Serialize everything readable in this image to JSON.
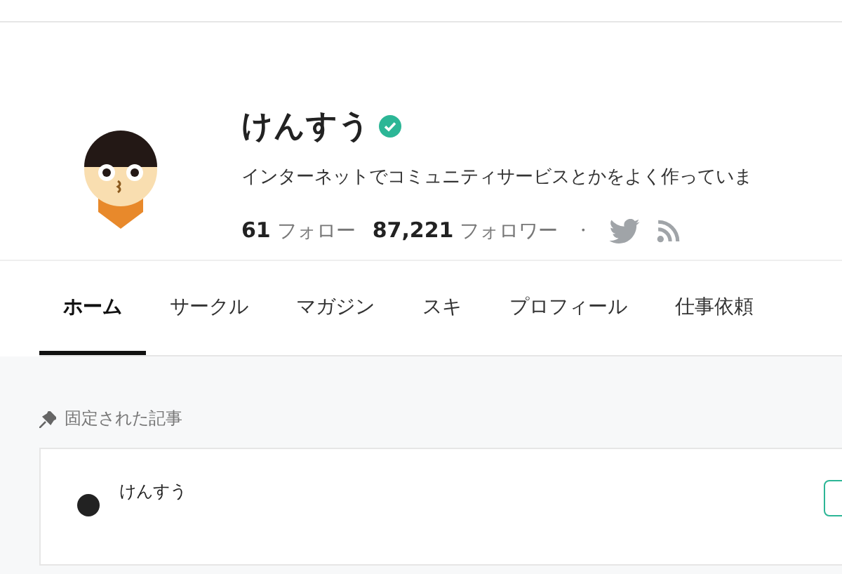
{
  "profile": {
    "name": "けんすう",
    "verified": true,
    "bio": "インターネットでコミュニティサービスとかをよく作っていま",
    "follow_count": "61",
    "follow_label": "フォロー",
    "follower_count": "87,221",
    "follower_label": "フォロワー",
    "separator": "・"
  },
  "tabs": [
    {
      "label": "ホーム",
      "selected": true
    },
    {
      "label": "サークル",
      "selected": false
    },
    {
      "label": "マガジン",
      "selected": false
    },
    {
      "label": "スキ",
      "selected": false
    },
    {
      "label": "プロフィール",
      "selected": false
    },
    {
      "label": "仕事依頼",
      "selected": false
    }
  ],
  "pinned": {
    "heading": "固定された記事",
    "author": "けんすう"
  }
}
